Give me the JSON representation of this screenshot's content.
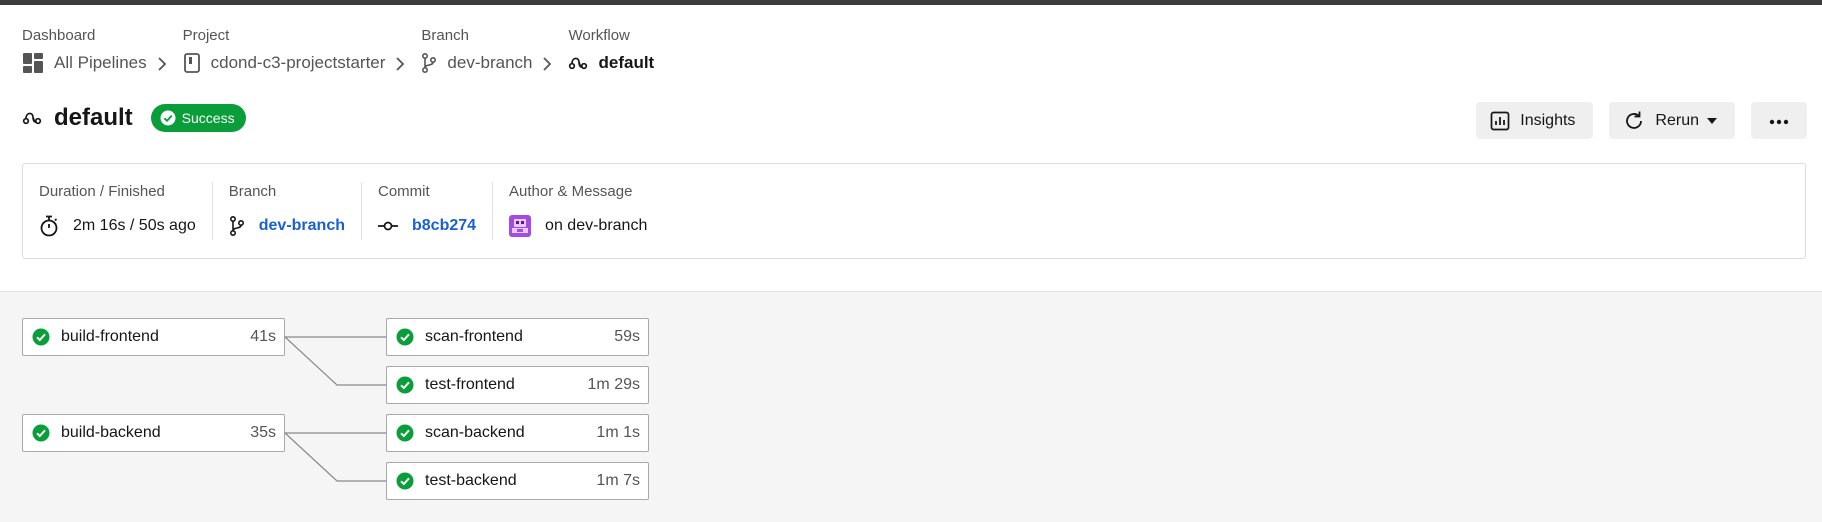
{
  "breadcrumbs": [
    {
      "category": "Dashboard",
      "label": "All Pipelines",
      "icon": "dashboard-icon"
    },
    {
      "category": "Project",
      "label": "cdond-c3-projectstarter",
      "icon": "project-icon"
    },
    {
      "category": "Branch",
      "label": "dev-branch",
      "icon": "branch-icon"
    },
    {
      "category": "Workflow",
      "label": "default",
      "icon": "workflow-icon"
    }
  ],
  "workflow": {
    "title": "default",
    "status": "Success",
    "status_color": "#0a9e3a"
  },
  "actions": {
    "insights_label": "Insights",
    "rerun_label": "Rerun",
    "more_icon": "more-icon"
  },
  "details": {
    "duration": {
      "label": "Duration / Finished",
      "value": "2m 16s / 50s ago"
    },
    "branch": {
      "label": "Branch",
      "value": "dev-branch"
    },
    "commit": {
      "label": "Commit",
      "value": "b8cb274"
    },
    "author": {
      "label": "Author & Message",
      "value": "on dev-branch"
    }
  },
  "jobs": [
    {
      "name": "build-frontend",
      "duration": "41s",
      "status": "success"
    },
    {
      "name": "scan-frontend",
      "duration": "59s",
      "status": "success"
    },
    {
      "name": "test-frontend",
      "duration": "1m 29s",
      "status": "success"
    },
    {
      "name": "build-backend",
      "duration": "35s",
      "status": "success"
    },
    {
      "name": "scan-backend",
      "duration": "1m 1s",
      "status": "success"
    },
    {
      "name": "test-backend",
      "duration": "1m 7s",
      "status": "success"
    }
  ],
  "colors": {
    "success": "#0a9e3a",
    "link": "#1a5fd6"
  }
}
